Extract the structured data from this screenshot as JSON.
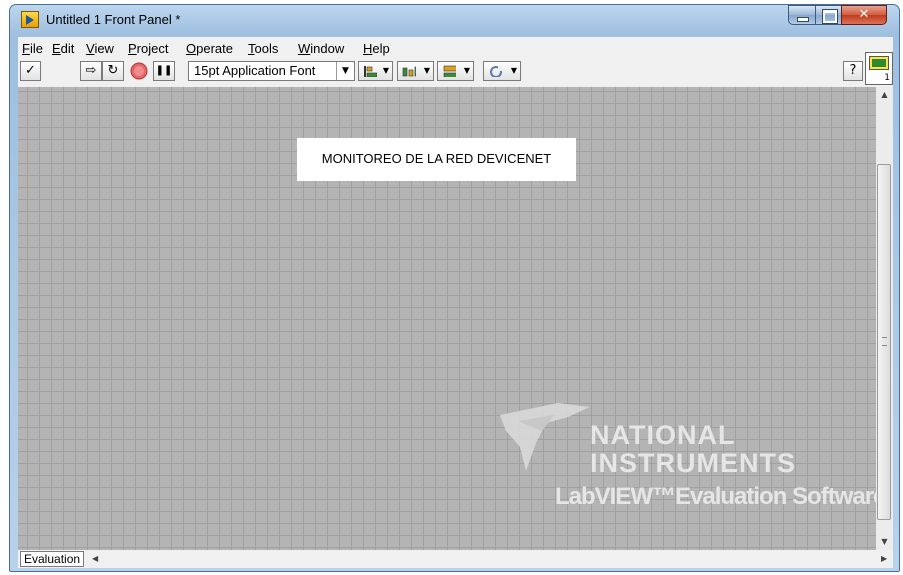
{
  "window": {
    "title": "Untitled 1 Front Panel *",
    "caption_buttons": {
      "close_glyph": "✕"
    }
  },
  "menubar": {
    "items": [
      {
        "label": "File",
        "accel": "F",
        "rest": "ile"
      },
      {
        "label": "Edit",
        "accel": "E",
        "rest": "dit"
      },
      {
        "label": "View",
        "accel": "V",
        "rest": "iew"
      },
      {
        "label": "Project",
        "accel": "P",
        "rest": "roject"
      },
      {
        "label": "Operate",
        "accel": "O",
        "rest": "perate"
      },
      {
        "label": "Tools",
        "accel": "T",
        "rest": "ools"
      },
      {
        "label": "Window",
        "accel": "W",
        "rest": "indow"
      },
      {
        "label": "Help",
        "accel": "H",
        "rest": "elp"
      }
    ]
  },
  "toolbar": {
    "checkmark_glyph": "✓",
    "run_glyph": "⇨",
    "run_continuous_glyph": "↻",
    "pause_glyph": "❚❚",
    "font": "15pt Application Font",
    "help_glyph": "?",
    "icons": [
      "checkmark-icon",
      "run-arrow-icon",
      "run-continuously-icon",
      "abort-icon",
      "pause-icon",
      "align-icon",
      "distribute-icon",
      "resize-icon",
      "reorder-icon",
      "help-icon"
    ]
  },
  "vi_icon": {
    "number": "1"
  },
  "panel": {
    "label": "MONITOREO DE LA RED DEVICENET"
  },
  "watermark": {
    "line1": "NATIONAL",
    "line2": "INSTRUMENTS",
    "line3": "LabVIEW™Evaluation Software"
  },
  "statusbar": {
    "tab": "Evaluation"
  },
  "colors": {
    "titlebar": "#9fbfe0",
    "panel_grid": "#b4b4b4",
    "abort_red": "#e04040"
  }
}
